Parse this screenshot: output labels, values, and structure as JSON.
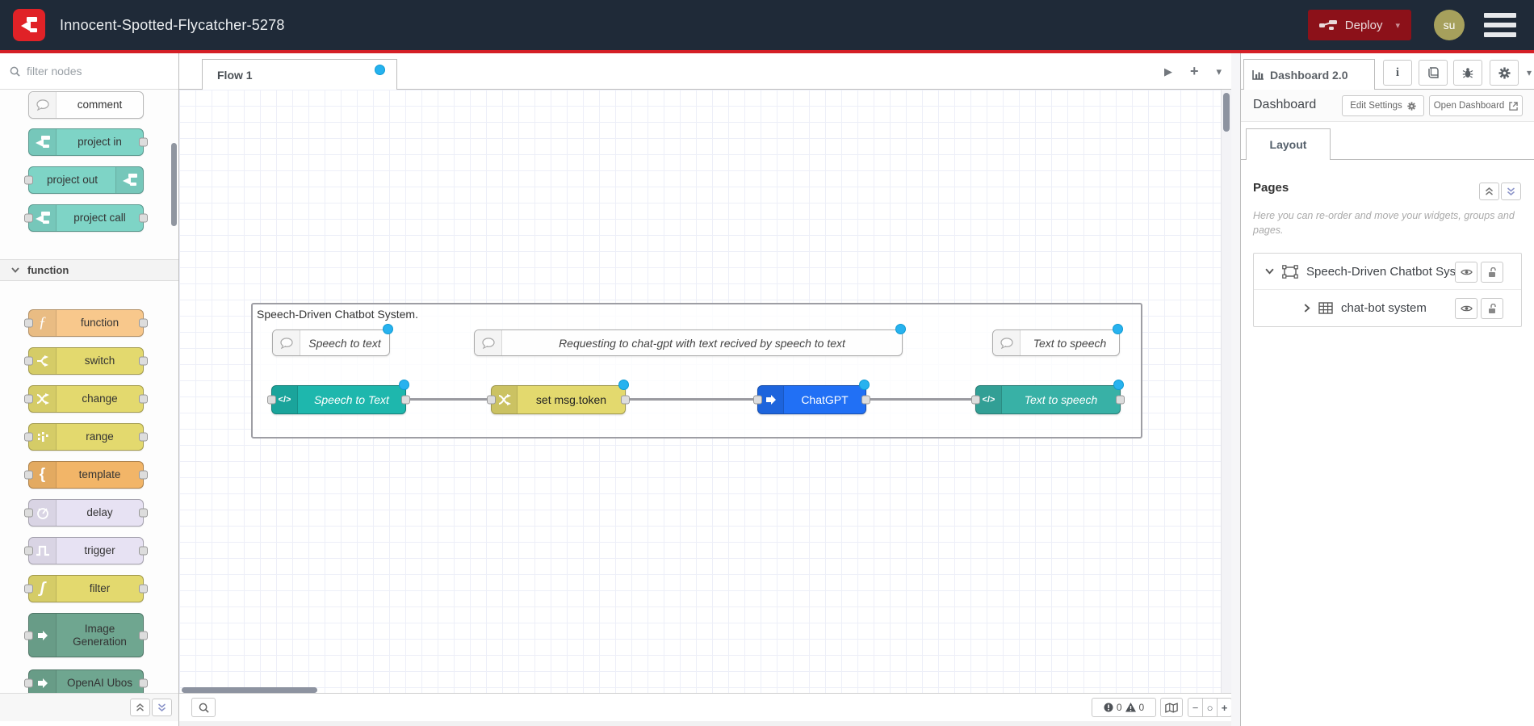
{
  "header": {
    "title": "Innocent-Spotted-Flycatcher-5278",
    "deploy_label": "Deploy",
    "avatar_initials": "su"
  },
  "icons": {
    "caret_down": "▾",
    "play": "▶",
    "plus": "+",
    "minus": "−",
    "zoom_reset": "○",
    "code_glyph": "</>",
    "function_glyph": "ƒ",
    "template_glyph": "{",
    "filter_glyph": "ʃ",
    "info_glyph": "i"
  },
  "palette": {
    "search_placeholder": "filter nodes",
    "items_top": [
      {
        "label": "comment"
      },
      {
        "label": "project in"
      },
      {
        "label": "project out"
      },
      {
        "label": "project call"
      }
    ],
    "category_function": {
      "label": "function",
      "items": [
        {
          "label": "function"
        },
        {
          "label": "switch"
        },
        {
          "label": "change"
        },
        {
          "label": "range"
        },
        {
          "label": "template"
        },
        {
          "label": "delay"
        },
        {
          "label": "trigger"
        },
        {
          "label": "filter"
        },
        {
          "label": "Image Generation"
        },
        {
          "label": "OpenAI Ubos"
        }
      ]
    }
  },
  "workspace": {
    "tab_label": "Flow 1",
    "group_label": "Speech-Driven Chatbot System.",
    "comments": [
      {
        "label": "Speech to text"
      },
      {
        "label": "Requesting to chat-gpt with text recived by speech to text"
      },
      {
        "label": "Text to speech"
      }
    ],
    "nodes": [
      {
        "label": "Speech to Text",
        "color": "#1eb7ad"
      },
      {
        "label": "set msg.token",
        "color": "#e3d96e"
      },
      {
        "label": "ChatGPT",
        "color": "#2170f5"
      },
      {
        "label": "Text to speech",
        "color": "#38b1a6"
      }
    ],
    "footer": {
      "error_count": "0",
      "warning_count": "0"
    }
  },
  "sidebar": {
    "tab_label": "Dashboard 2.0",
    "section_title": "Dashboard",
    "edit_settings_label": "Edit Settings",
    "open_dashboard_label": "Open Dashboard",
    "layout_tab_label": "Layout",
    "pages_title": "Pages",
    "pages_hint": "Here you can re-order and move your widgets, groups and pages.",
    "tree": [
      {
        "label": "Speech-Driven Chatbot System"
      },
      {
        "label": "chat-bot system"
      }
    ]
  },
  "colors": {
    "header_bg": "#1f2a38",
    "brand_red": "#d41f26",
    "deploy_btn": "#8c1119",
    "avatar_bg": "#a6a05c",
    "node_teal_project": "#7ed4c6",
    "node_peach_function": "#f8c88c",
    "node_yellow": "#e3d96e",
    "node_orange_template": "#f2b568",
    "node_lavender": "#e7e2f3",
    "node_green_openai": "#6fa690",
    "node_blue_chatgpt": "#2170f5",
    "changed_dot": "#27b2ef",
    "wire": "#9a9aa0"
  }
}
